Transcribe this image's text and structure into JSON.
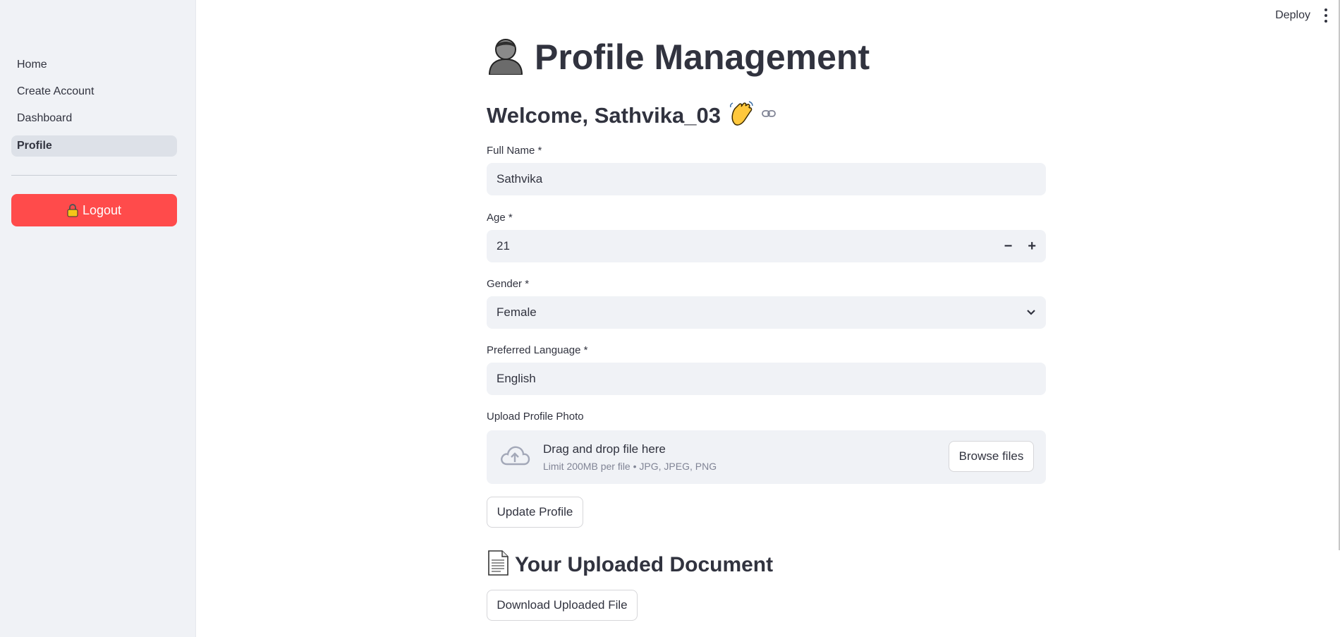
{
  "sidebar": {
    "items": [
      {
        "label": "Home"
      },
      {
        "label": "Create Account"
      },
      {
        "label": "Dashboard"
      },
      {
        "label": "Profile"
      }
    ],
    "logout_label": "Logout"
  },
  "header": {
    "deploy_label": "Deploy"
  },
  "main": {
    "title": "Profile Management",
    "welcome": "Welcome, Sathvika_03",
    "fields": {
      "full_name": {
        "label": "Full Name *",
        "value": "Sathvika"
      },
      "age": {
        "label": "Age *",
        "value": "21",
        "minus": "−",
        "plus": "+"
      },
      "gender": {
        "label": "Gender *",
        "value": "Female"
      },
      "language": {
        "label": "Preferred Language *",
        "value": "English"
      }
    },
    "upload": {
      "label": "Upload Profile Photo",
      "title": "Drag and drop file here",
      "limit": "Limit 200MB per file • JPG, JPEG, PNG",
      "browse_label": "Browse files"
    },
    "update_label": "Update Profile",
    "documents_heading": "Your Uploaded Document",
    "download_label": "Download Uploaded File"
  },
  "colors": {
    "accent": "#ff4b4b",
    "sidebar_bg": "#f0f2f6",
    "input_bg": "#f0f2f6",
    "text": "#31333f"
  }
}
